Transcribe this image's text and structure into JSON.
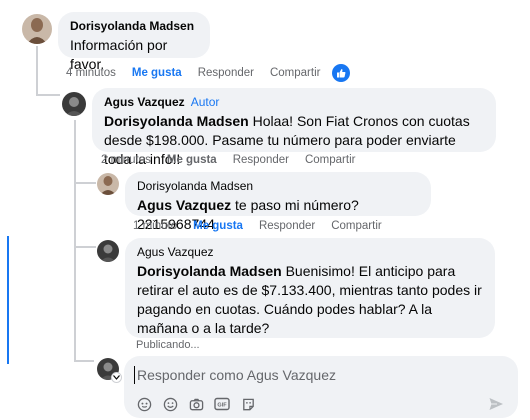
{
  "comments": [
    {
      "author": "Dorisyolanda Madsen",
      "badge": "",
      "mention": "",
      "text": "Información por favor.",
      "time": "4 minutos",
      "like_label": "Me gusta",
      "reply_label": "Responder",
      "share_label": "Compartir",
      "has_like_reaction": true
    },
    {
      "author": "Agus Vazquez",
      "badge": "Autor",
      "mention": "Dorisyolanda Madsen",
      "text": " Holaa! Son Fiat Cronos con cuotas desde $198.000. Pasame tu número para poder enviarte toda la info!!",
      "time": "2 minutos",
      "like_label": "Me gusta",
      "reply_label": "Responder",
      "share_label": "Compartir"
    },
    {
      "author": "Dorisyolanda Madsen",
      "mention": "Agus Vazquez",
      "text": " te paso mi número? 2215968744",
      "time": "1 minuto",
      "like_label": "Me gusta",
      "reply_label": "Responder",
      "share_label": "Compartir"
    },
    {
      "author": "Agus Vazquez",
      "mention": "Dorisyolanda Madsen",
      "text": " Buenisimo! El anticipo para retirar el auto es de $7.133.400, mientras tanto podes ir pagando en cuotas. Cuándo podes hablar? A la mañana o a la tarde?",
      "status": "Publicando..."
    }
  ],
  "reply_box": {
    "placeholder": "Responder como Agus Vazquez",
    "tools": [
      "sticker-icon",
      "emoji-icon",
      "camera-icon",
      "gif-icon",
      "avatar-sticker-icon"
    ]
  },
  "colors": {
    "link_blue": "#1877f2",
    "bubble_bg": "#f0f2f5",
    "meta_gray": "#65676b"
  }
}
